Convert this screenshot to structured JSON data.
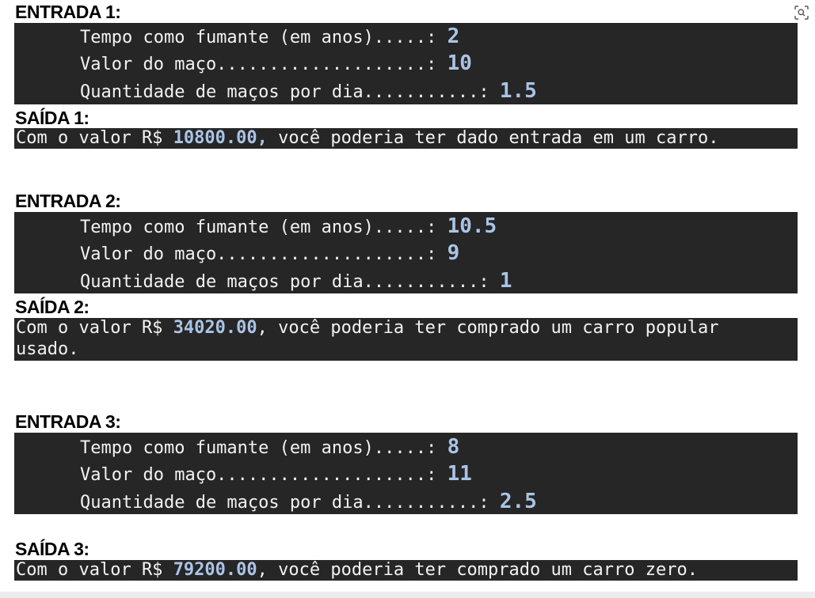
{
  "labels": {
    "tempo": "Tempo como fumante (em anos).....: ",
    "valor": "Valor do maço....................: ",
    "quantidade": "Quantidade de maços por dia...........: "
  },
  "cases": [
    {
      "entrada_title": "ENTRADA 1:",
      "tempo": "2",
      "valor": "10",
      "quantidade": "1.5",
      "saida_title": "SAÍDA 1:",
      "saida_prefix": "Com o valor R$ ",
      "saida_value": "10800.00,",
      "saida_suffix": " você poderia ter dado entrada em um carro."
    },
    {
      "entrada_title": "ENTRADA 2:",
      "tempo": "10.5",
      "valor": "9",
      "quantidade": "1",
      "saida_title": "SAÍDA 2:",
      "saida_prefix": "Com o valor R$ ",
      "saida_value": "34020.00",
      "saida_suffix": ", você poderia ter comprado um carro popular",
      "saida_line2": "usado."
    },
    {
      "entrada_title": "ENTRADA 3:",
      "tempo": "8",
      "valor": "11",
      "quantidade": "2.5",
      "saida_title": "SAÍDA 3:",
      "saida_prefix": "Com o valor R$ ",
      "saida_value": "79200.00",
      "saida_suffix": ", você poderia ter comprado um carro zero."
    }
  ],
  "icons": {
    "top_right": "visual-search-icon"
  }
}
